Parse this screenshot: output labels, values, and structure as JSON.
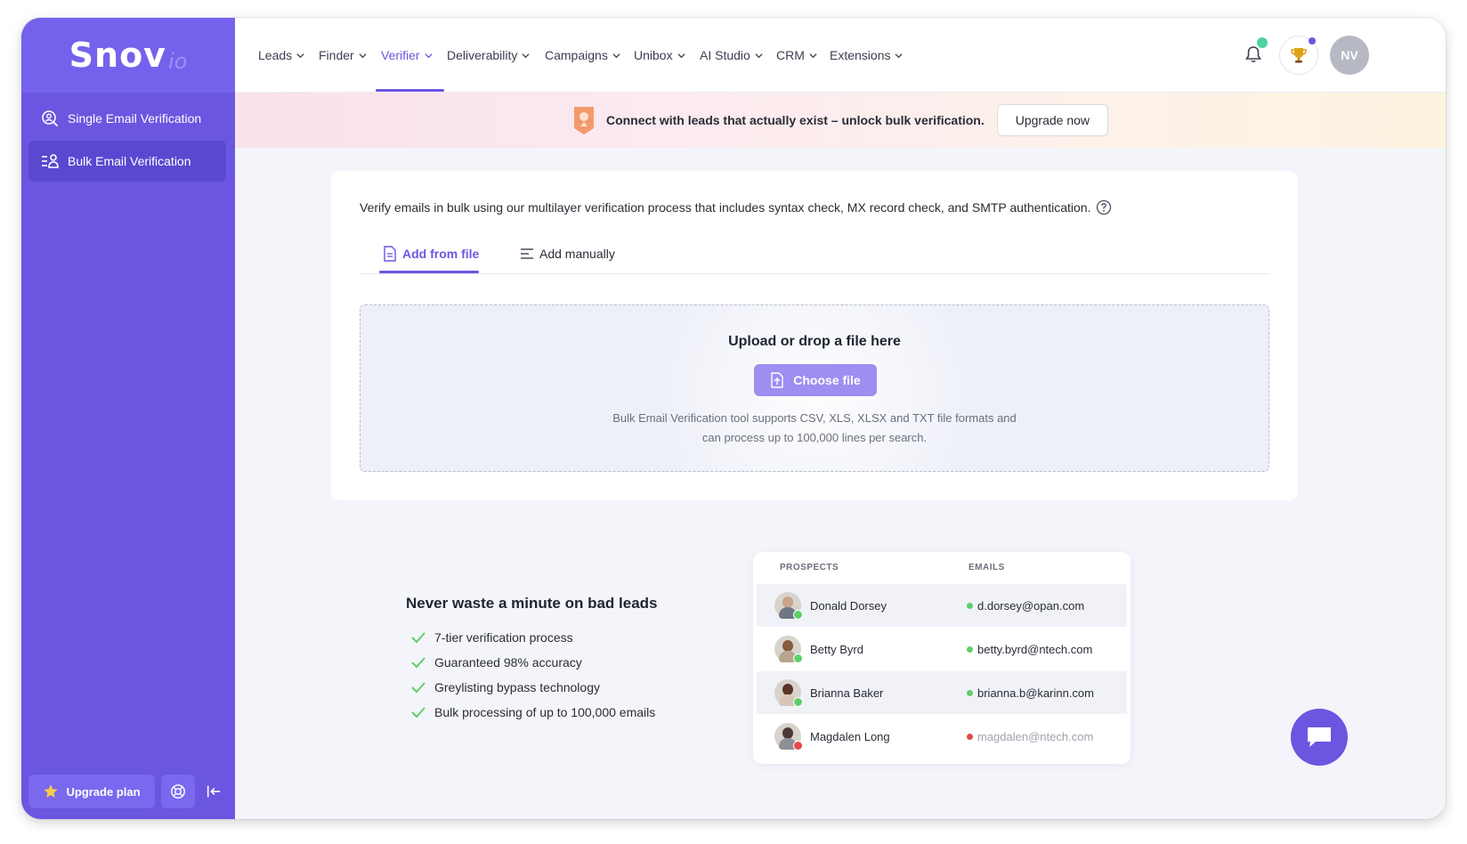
{
  "brand": {
    "name": "Snov",
    "suffix": "io"
  },
  "sidebar": {
    "items": [
      {
        "label": "Single Email Verification",
        "icon": "search-user-icon",
        "active": false
      },
      {
        "label": "Bulk Email Verification",
        "icon": "bulk-users-icon",
        "active": true
      }
    ],
    "upgrade_label": "Upgrade plan"
  },
  "nav": {
    "items": [
      {
        "label": "Leads"
      },
      {
        "label": "Finder"
      },
      {
        "label": "Verifier",
        "active": true
      },
      {
        "label": "Deliverability"
      },
      {
        "label": "Campaigns"
      },
      {
        "label": "Unibox"
      },
      {
        "label": "AI Studio"
      },
      {
        "label": "CRM"
      },
      {
        "label": "Extensions"
      }
    ],
    "avatar_initials": "NV"
  },
  "banner": {
    "text": "Connect with leads that actually exist – unlock bulk verification.",
    "button": "Upgrade now"
  },
  "main": {
    "description": "Verify emails in bulk using our multilayer verification process that includes syntax check, MX record check, and SMTP authentication.",
    "tabs": [
      {
        "label": "Add from file",
        "active": true
      },
      {
        "label": "Add manually",
        "active": false
      }
    ],
    "dropzone": {
      "title": "Upload or drop a file here",
      "button": "Choose file",
      "note_line1": "Bulk Email Verification tool supports CSV, XLS, XLSX and TXT file formats and",
      "note_line2": "can process up to 100,000 lines per search."
    }
  },
  "promo": {
    "title": "Never waste a minute on bad leads",
    "features": [
      "7-tier verification process",
      "Guaranteed 98% accuracy",
      "Greylisting bypass technology",
      "Bulk processing of up to 100,000 emails"
    ],
    "table": {
      "headers": {
        "prospects": "PROSPECTS",
        "emails": "EMAILS"
      },
      "rows": [
        {
          "name": "Donald Dorsey",
          "email": "d.dorsey@opan.com",
          "status": "valid"
        },
        {
          "name": "Betty Byrd",
          "email": "betty.byrd@ntech.com",
          "status": "valid"
        },
        {
          "name": "Brianna Baker",
          "email": "brianna.b@karinn.com",
          "status": "valid"
        },
        {
          "name": "Magdalen Long",
          "email": "magdalen@ntech.com",
          "status": "invalid"
        }
      ]
    }
  },
  "colors": {
    "accent": "#6a56e0",
    "valid": "#5fcf6b",
    "invalid": "#e5484d"
  }
}
